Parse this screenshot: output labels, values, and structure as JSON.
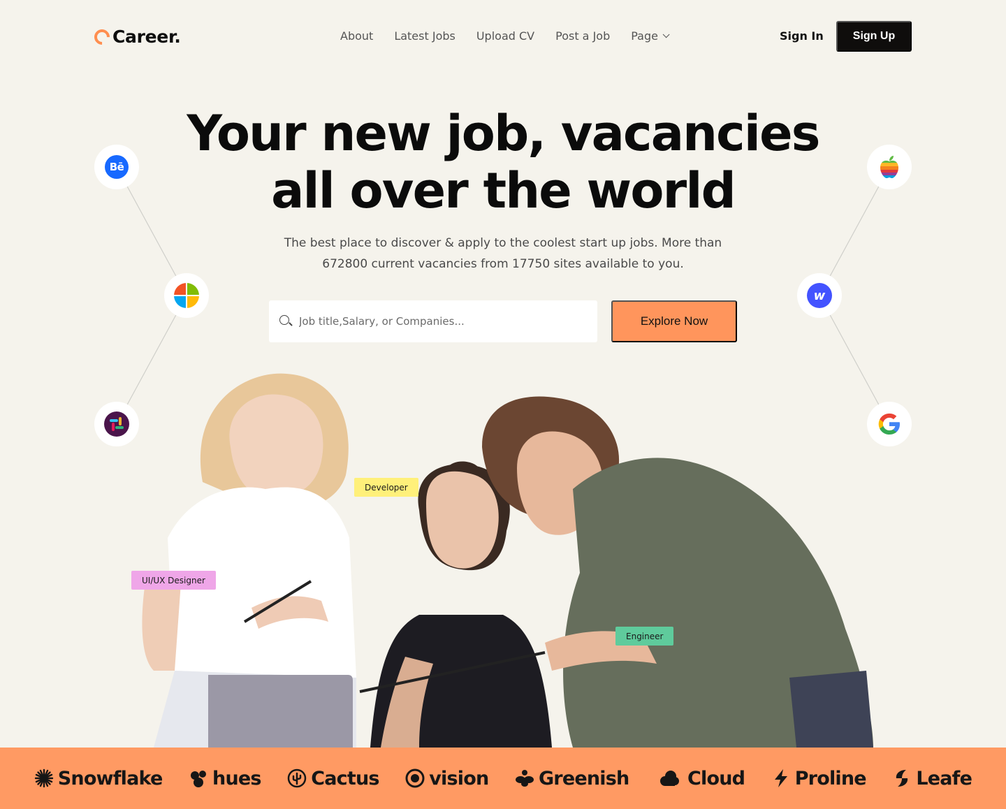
{
  "nav": {
    "logo_text": "Career.",
    "links": [
      {
        "label": "About"
      },
      {
        "label": "Latest Jobs"
      },
      {
        "label": "Upload CV"
      },
      {
        "label": "Post a Job"
      },
      {
        "label": "Page"
      }
    ],
    "sign_in": "Sign In",
    "sign_up": "Sign Up"
  },
  "hero": {
    "title_line1": "Your new job, vacancies",
    "title_line2": "all over the world",
    "subtitle_line1": "The best place to discover & apply to the coolest start up jobs. More than",
    "subtitle_line2": "672800 current vacancies from 17750 sites available to you.",
    "search_placeholder": "Job title,Salary, or Companies...",
    "explore_label": "Explore Now"
  },
  "company_icons": {
    "left": [
      "behance-icon",
      "microsoft-icon",
      "slack-icon"
    ],
    "right": [
      "apple-icon",
      "webflow-icon",
      "google-icon"
    ],
    "behance_text": "Bē",
    "webflow_text": "w",
    "google_text": "G"
  },
  "tags": {
    "developer": "Developer",
    "ux": "UI/UX Designer",
    "engineer": "Engineer"
  },
  "brands": [
    {
      "name": "Snowflake",
      "icon": "snowflake-icon"
    },
    {
      "name": "hues",
      "icon": "hues-icon"
    },
    {
      "name": "Cactus",
      "icon": "cactus-icon"
    },
    {
      "name": "vision",
      "icon": "vision-icon"
    },
    {
      "name": "Greenish",
      "icon": "greenish-icon"
    },
    {
      "name": "Cloud",
      "icon": "cloud-icon"
    },
    {
      "name": "Proline",
      "icon": "proline-icon"
    },
    {
      "name": "Leafe",
      "icon": "leafe-icon"
    }
  ],
  "colors": {
    "background": "#F5F3EC",
    "accent": "#FF955C",
    "strip": "#FF9A63",
    "dark": "#0F0D0C"
  }
}
